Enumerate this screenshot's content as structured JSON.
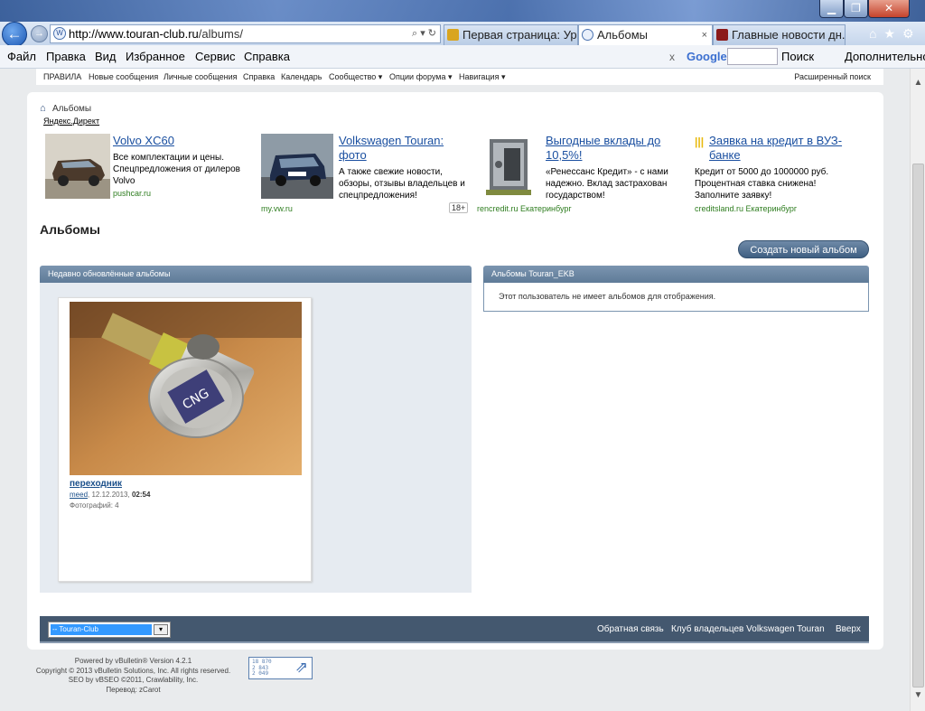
{
  "browser": {
    "address": {
      "host": "http://www.touran-club.ru",
      "path": "/albums/"
    },
    "tabs": [
      {
        "label": "Первая страница: Ур..."
      },
      {
        "label": "Альбомы",
        "close": "×"
      },
      {
        "label": "Главные новости дн..."
      }
    ],
    "menu": [
      "Файл",
      "Правка",
      "Вид",
      "Избранное",
      "Сервис",
      "Справка"
    ],
    "google_toolbar": {
      "close": "x",
      "logo": "Google",
      "search_label": "Поиск",
      "more_label": "Дополнительно"
    }
  },
  "forum_nav": {
    "links": [
      "ПРАВИЛА",
      "Новые сообщения",
      "Личные сообщения",
      "Справка",
      "Календарь",
      "Сообщество ▾",
      "Опции форума ▾",
      "Навигация ▾"
    ],
    "advanced_search": "Расширенный поиск"
  },
  "breadcrumb": {
    "current": "Альбомы"
  },
  "yandex_direct": "Яндекс.Директ",
  "ads": [
    {
      "title": "Volvo XC60",
      "text": "Все комплектации и цены. Спецпредложения от дилеров Volvo",
      "domain": "pushcar.ru"
    },
    {
      "title": "Volkswagen Touran: фото",
      "text": "А также свежие новости, обзоры, отзывы владельцев и спецпредложения!",
      "domain": "my.vw.ru",
      "age": "18+"
    },
    {
      "title": "Выгодные вклады до 10,5%!",
      "text": "«Ренессанс Кредит» - с нами надежно. Вклад застрахован государством!",
      "domain": "rencredit.ru Екатеринбург"
    },
    {
      "title": "Заявка на кредит в ВУЗ-банке",
      "text": "Кредит от 5000 до 1000000 руб. Процентная ставка снижена! Заполните заявку!",
      "domain": "creditsland.ru Екатеринбург"
    }
  ],
  "page": {
    "title": "Альбомы",
    "create_album": "Создать новый альбом"
  },
  "recent": {
    "heading": "Недавно обновлённые альбомы",
    "album": {
      "name": "переходник",
      "user": "meed",
      "date": ", 12.12.2013, ",
      "time": "02:54",
      "photos": "Фотографий: 4",
      "plate_text": "CNG"
    }
  },
  "user_albums": {
    "heading": "Альбомы Touran_EKB",
    "empty": "Этот пользователь не имеет альбомов для отображения."
  },
  "footer": {
    "style_select": "-- Touran-Club",
    "links": [
      "Обратная связь",
      "Клуб владельцев Volkswagen Touran",
      "Вверх"
    ]
  },
  "powered": {
    "lines": [
      "Powered by vBulletin® Version 4.2.1",
      "Copyright © 2013 vBulletin Solutions, Inc. All rights reserved.",
      "SEO by vBSEO ©2011, Crawlability, Inc.",
      "Перевод: zCarot"
    ],
    "counter": [
      "18 870",
      "2 843",
      "2 049"
    ]
  },
  "colors": {
    "link": "#1a4fa0",
    "block_head": "#6b87a3",
    "footer_bar": "#44586f",
    "button": "#4f6d8f"
  }
}
